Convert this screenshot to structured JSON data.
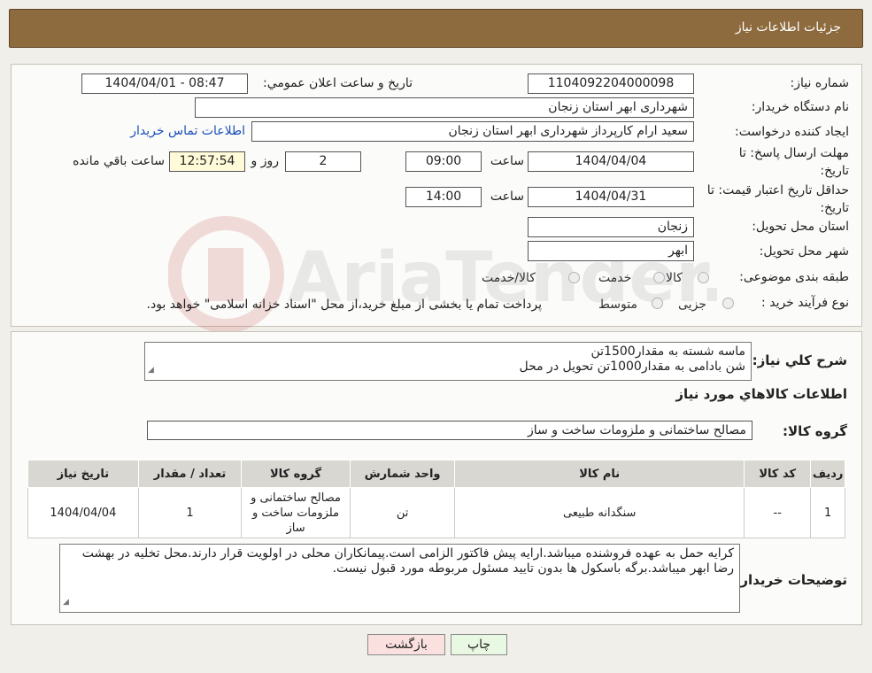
{
  "header": {
    "title": "جزئیات اطلاعات نیاز"
  },
  "form": {
    "need_number_label": "شماره نیاز:",
    "need_number": "1104092204000098",
    "announce_label": "تاریخ و ساعت اعلان عمومي:",
    "announce_value": "1404/04/01 - 08:47",
    "buyer_org_label": "نام دستگاه خريدار:",
    "buyer_org": "شهرداری ابهر استان زنجان",
    "requester_label": "ايجاد کننده درخواست:",
    "requester": "سعید ارام کارپرداز  شهرداری ابهر استان زنجان",
    "contact_link": "اطلاعات تماس خريدار",
    "deadline_label": "مهلت ارسال پاسخ: تا تاریخ:",
    "deadline_date": "1404/04/04",
    "time_label": "ساعت",
    "deadline_time": "09:00",
    "days_value": "2",
    "days_label": "روز و",
    "remaining_time": "12:57:54",
    "remaining_label": "ساعت باقي مانده",
    "validity_label": "حداقل تاريخ اعتبار قيمت: تا تاریخ:",
    "validity_date": "1404/04/31",
    "validity_time": "14:00",
    "province_label": "استان محل تحويل:",
    "province": "زنجان",
    "city_label": "شهر محل تحويل:",
    "city": "ابهر",
    "category_label": "طبقه بندی موضوعی:",
    "category_options": [
      "کالا",
      "خدمت",
      "کالا/خدمت"
    ],
    "purchase_type_label": "نوع فرآيند خريد :",
    "purchase_options": [
      "جزیی",
      "متوسط"
    ],
    "purchase_note": "پرداخت تمام یا بخشی از مبلغ خرید،از محل \"اسناد خزانه اسلامی\" خواهد بود."
  },
  "watermark": {
    "text": "AriaTender.neT"
  },
  "summary": {
    "label": "شرح کلي نياز:",
    "lines": [
      "ماسه شسته به مقدار1500تن",
      "شن بادامی به مقدار1000تن تحویل در محل"
    ],
    "goods_info_title": "اطلاعات کالاهاي مورد نياز",
    "group_label": "گروه کالا:",
    "group_value": "مصالح ساختمانی و ملزومات ساخت و ساز"
  },
  "table": {
    "headers": [
      "رديف",
      "کد کالا",
      "نام کالا",
      "واحد شمارش",
      "گروه کالا",
      "تعداد / مقدار",
      "تاریخ نیاز"
    ],
    "rows": [
      [
        "1",
        "--",
        "سنگدانه طبیعی",
        "تن",
        "مصالح ساختمانی و ملزومات ساخت و ساز",
        "1",
        "1404/04/04"
      ]
    ]
  },
  "buyer_notes": {
    "label": "توضيحات خريدار:",
    "text": "کرایه حمل به عهده فروشنده میباشد.ارایه پیش فاکتور الزامی است.پیمانکاران محلی در اولویت قرار دارند.محل تخلیه در بهشت رضا ابهر میباشد.برگه باسکول ها بدون تایید مسئول مربوطه مورد قبول نیست."
  },
  "buttons": {
    "print": "چاپ",
    "back": "بازگشت"
  },
  "colors": {
    "header_bg": "#8e6b3e",
    "back_btn_bg": "#fbe0e0",
    "print_btn_bg": "#e8f8e2",
    "link": "#1a4fb8"
  }
}
